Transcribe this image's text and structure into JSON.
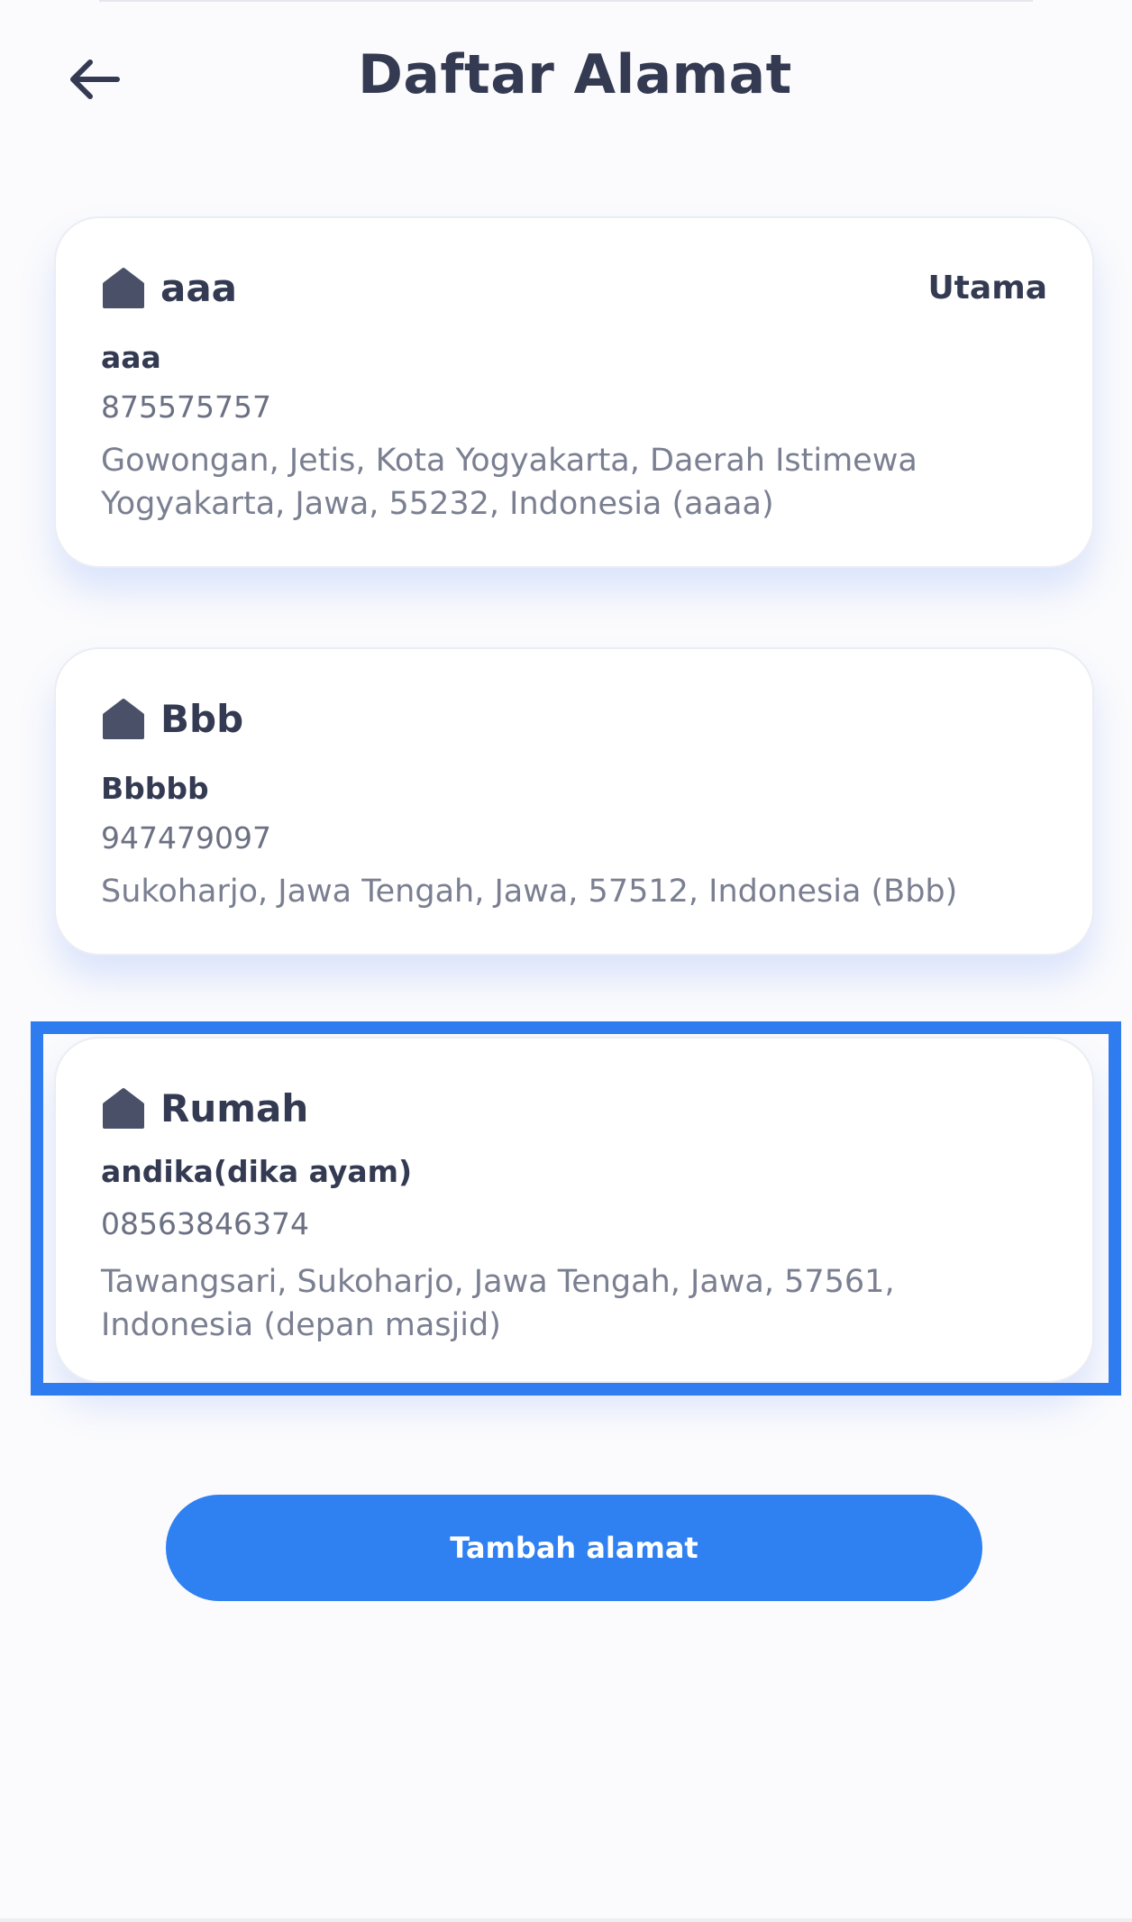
{
  "header": {
    "title": "Daftar Alamat",
    "back_icon": "arrow-left-icon"
  },
  "addresses": [
    {
      "label": "aaa",
      "primary_tag": "Utama",
      "recipient": "aaa",
      "phone": "875575757",
      "address": "Gowongan, Jetis, Kota Yogyakarta, Daerah Istimewa Yogyakarta, Jawa, 55232, Indonesia (aaaa)",
      "icon": "home-icon"
    },
    {
      "label": "Bbb",
      "recipient": "Bbbbb",
      "phone": "947479097",
      "address": "Sukoharjo, Jawa Tengah, Jawa, 57512, Indonesia (Bbb)",
      "icon": "home-icon"
    },
    {
      "label": "Rumah",
      "recipient": "andika(dika ayam)",
      "phone": "08563846374",
      "address": "Tawangsari, Sukoharjo, Jawa Tengah, Jawa, 57561, Indonesia (depan masjid)",
      "icon": "home-icon",
      "highlighted": true
    }
  ],
  "add_button": {
    "label": "Tambah alamat"
  },
  "colors": {
    "accent": "#2f80f0",
    "highlight": "#2f7bf0",
    "text_dark": "#333a52",
    "text_muted": "#7a7f91"
  }
}
